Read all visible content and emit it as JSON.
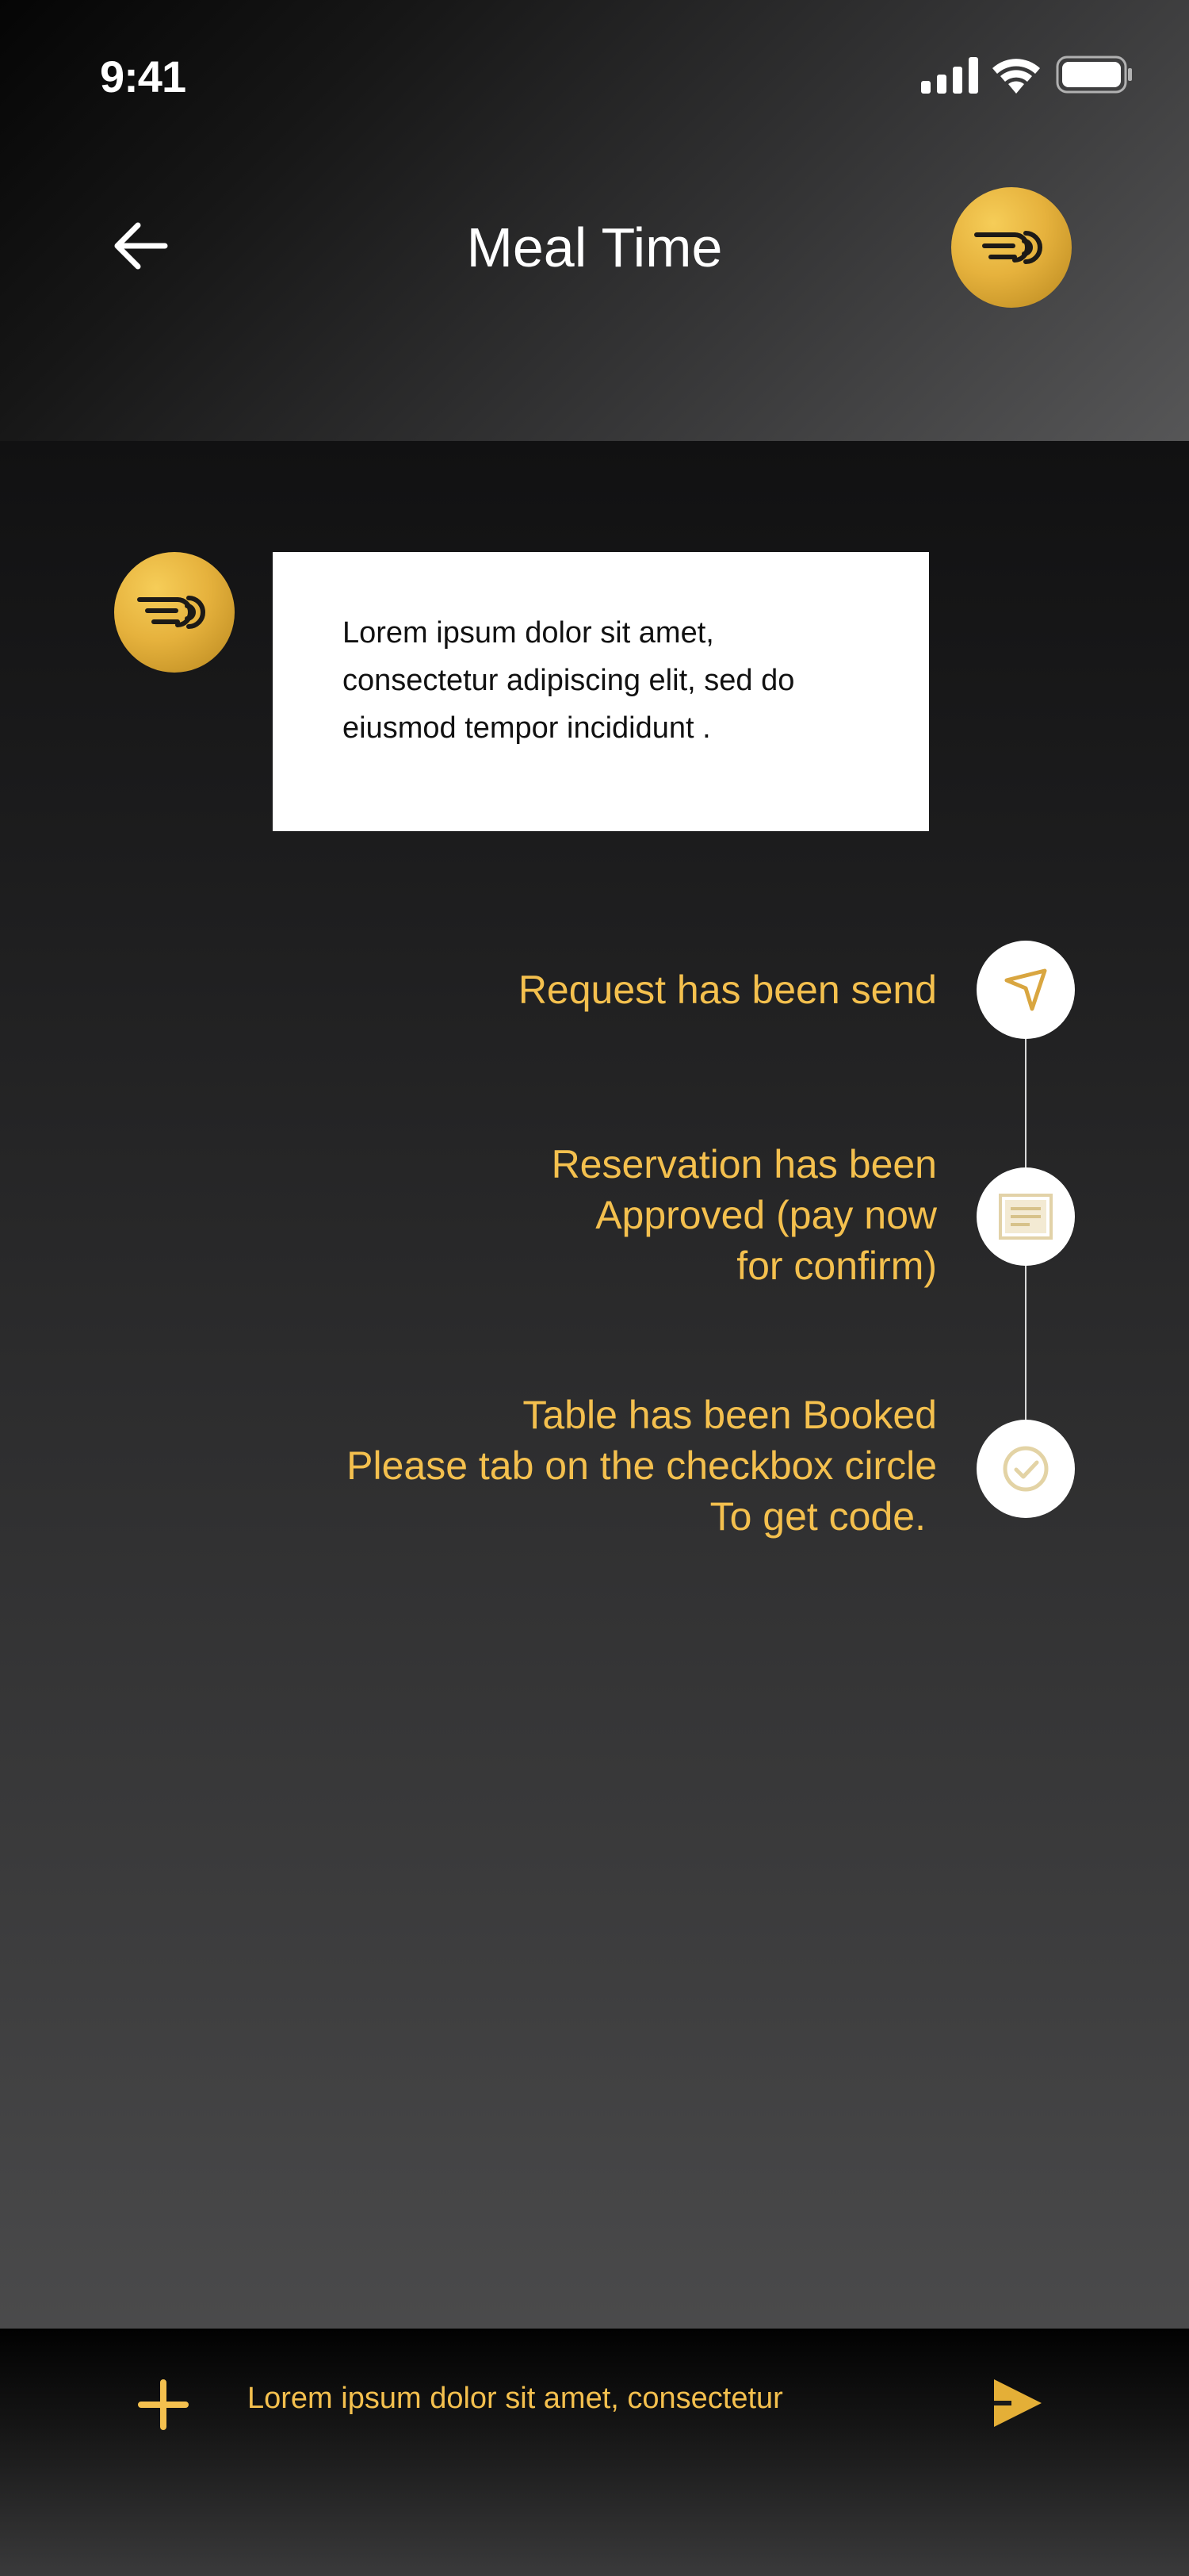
{
  "status_bar": {
    "time": "9:41",
    "icons": [
      "signal-icon",
      "wifi-icon",
      "battery-icon"
    ]
  },
  "header": {
    "title": "Meal Time",
    "back_icon": "arrow-left-icon",
    "logo_icon": "brand-logo-icon"
  },
  "chat": {
    "sender_icon": "brand-logo-icon",
    "message": "Lorem ipsum dolor sit amet, consectetur adipiscing elit, sed do eiusmod tempor incididunt ."
  },
  "timeline": {
    "steps": [
      {
        "lines": [
          "Request has been send"
        ],
        "icon": "send-icon"
      },
      {
        "lines": [
          "Reservation has been",
          "Approved (pay now",
          "for confirm)"
        ],
        "icon": "document-icon"
      },
      {
        "lines": [
          "Table has been Booked",
          "Please tab on the checkbox circle",
          "To get code."
        ],
        "icon": "checkmark-circle-icon"
      }
    ]
  },
  "composer": {
    "add_icon": "plus-icon",
    "input_placeholder": "Lorem ipsum dolor sit amet, consectetur",
    "send_icon": "send-arrow-icon"
  },
  "colors": {
    "accent": "#f4c04e",
    "logo_gold": "#e6b23d",
    "bubble": "#ffffff"
  }
}
